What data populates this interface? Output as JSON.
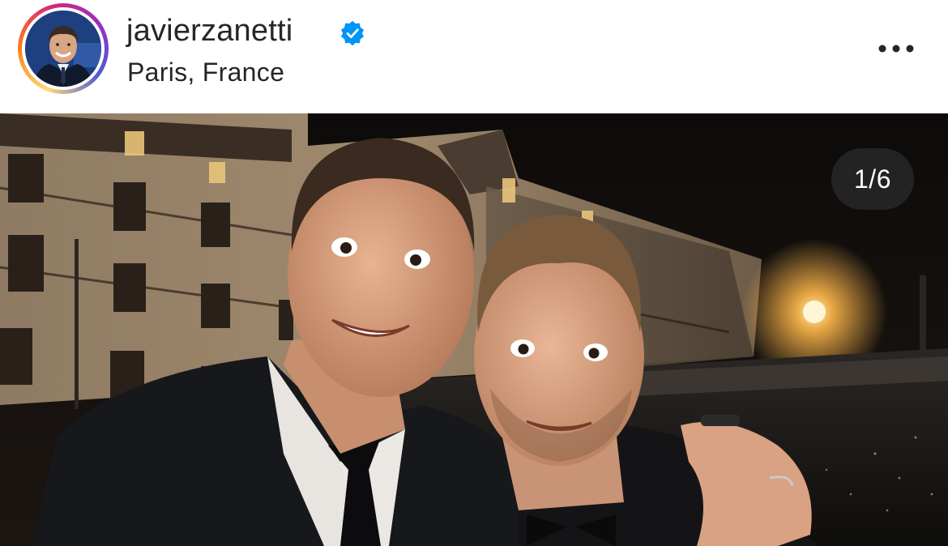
{
  "post_header": {
    "username": "javierzanetti",
    "verified_icon": "verified-badge-icon",
    "location": "Paris, France",
    "more_icon": "more-options-icon"
  },
  "media": {
    "counter": "1/6",
    "description_icon": "photo"
  },
  "colors": {
    "text": "#262626",
    "verified_blue": "#0095f6",
    "counter_bg": "#282828"
  }
}
